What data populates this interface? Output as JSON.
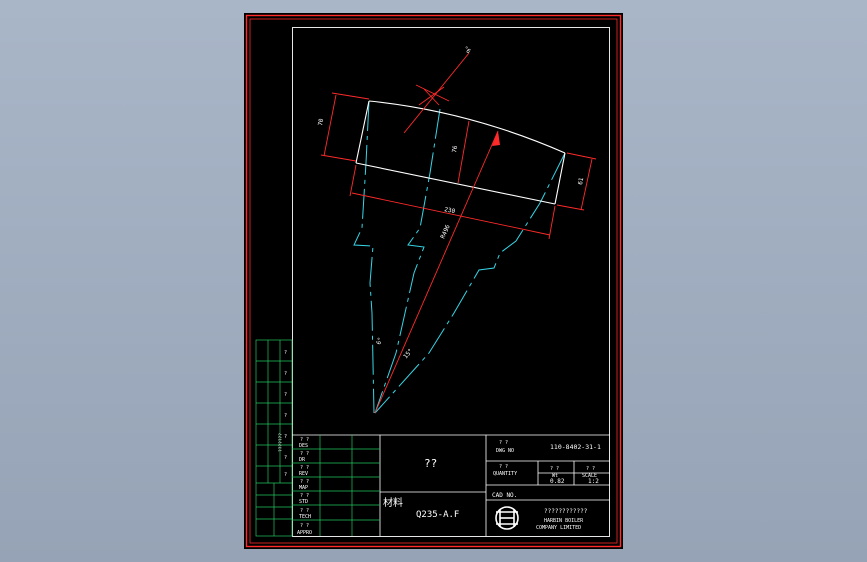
{
  "colors": {
    "background": "#000000",
    "border": "#ff2a2a",
    "frame": "#ffffff",
    "grid": "#22c55e",
    "outline": "#ffffff",
    "centerline": "#36d6e7",
    "dimension": "#ff2a2a"
  },
  "drawing": {
    "dim_top_angle": "°6",
    "dim_left": "70",
    "dim_mid": "76",
    "dim_right": "61",
    "dim_base": "230",
    "dim_radius": "R496",
    "dim_angle_left": "6°",
    "dim_angle_right": "15°"
  },
  "title_block": {
    "part_name": "??",
    "material_label": "材料",
    "material_value": "Q235-A.F",
    "dwg_no_label": "? ?",
    "dwg_no_caption": "DWG NO",
    "dwg_no_value": "110-8402-31-1",
    "quantity_label": "? ?",
    "quantity_caption": "QUANTITY",
    "wt_label": "? ?",
    "wt_caption": "Wt",
    "wt_value": "0.82",
    "scale_label": "? ?",
    "scale_caption": "SCALE",
    "scale_value": "1:2",
    "cad_no": "CAD NO.",
    "company_cn": "????????????",
    "company_en_1": "HARBIN BOILER",
    "company_en_2": "COMPANY LIMITED"
  },
  "sign_rows": [
    {
      "cn": "? ?",
      "en": "DES"
    },
    {
      "cn": "? ?",
      "en": "DR"
    },
    {
      "cn": "? ?",
      "en": "REV"
    },
    {
      "cn": "? ?",
      "en": "MAP"
    },
    {
      "cn": "? ?",
      "en": "STD"
    },
    {
      "cn": "? ?",
      "en": "TECH"
    },
    {
      "cn": "? ?",
      "en": "APPRO"
    }
  ],
  "side_grid_marks": [
    "?",
    "?",
    "?",
    "?",
    "?",
    "?",
    "?"
  ],
  "side_grid_label": "???????"
}
